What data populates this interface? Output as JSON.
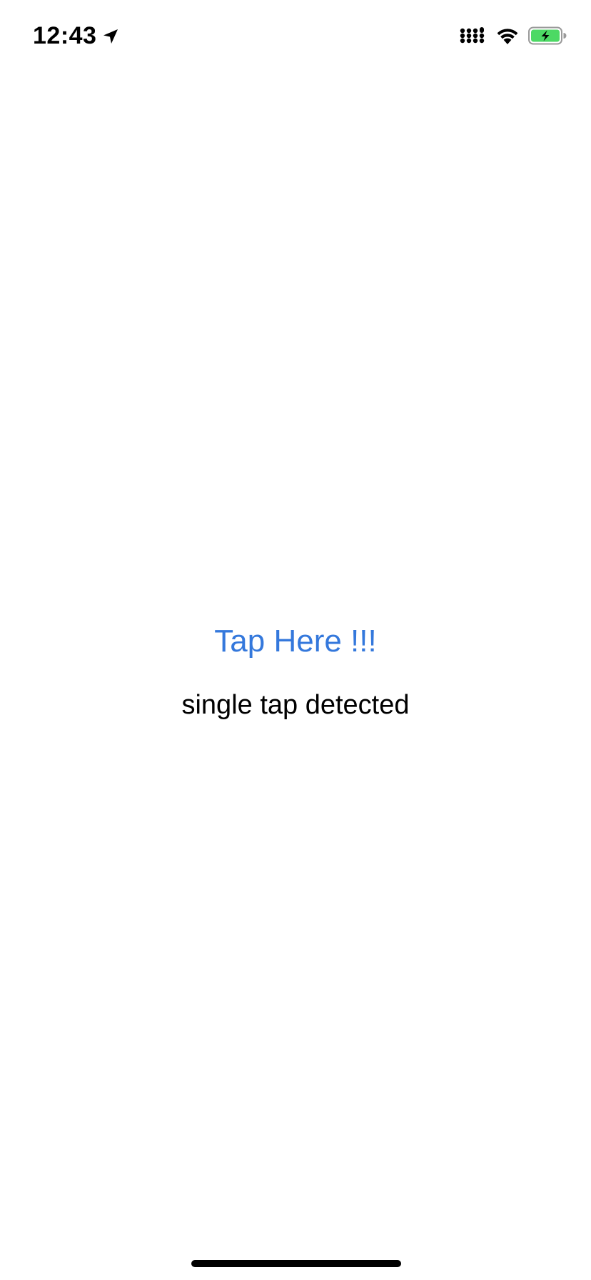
{
  "status_bar": {
    "time": "12:43",
    "icons": {
      "location": "location-arrow-icon",
      "signal": "cellular-signal-icon",
      "wifi": "wifi-icon",
      "battery": "battery-charging-icon"
    },
    "battery_color": "#4cd964"
  },
  "main": {
    "tap_button_label": "Tap Here !!!",
    "status_text": "single tap detected"
  },
  "colors": {
    "accent": "#3478dc",
    "text": "#000000",
    "background": "#ffffff"
  }
}
